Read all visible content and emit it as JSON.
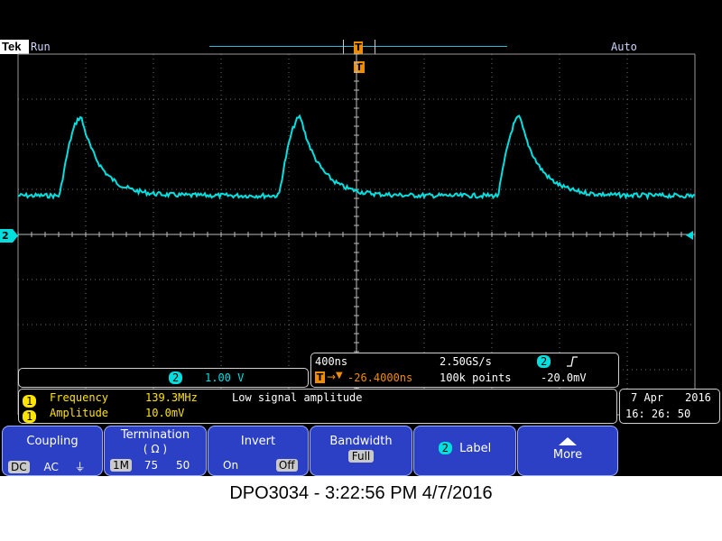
{
  "header": {
    "brand": "Tek",
    "acq_state": "Run",
    "trigger_mode": "Auto",
    "trigger_marker": "T"
  },
  "colors": {
    "ch1": "#ffe400",
    "ch2": "#00dede",
    "trigger": "#f08c00",
    "menu_bg": "#2b40c4",
    "graticule": "#8a8a8a"
  },
  "channel2": {
    "badge": "2",
    "scale": "1.00 V"
  },
  "horizontal": {
    "time_per_div": "400ns",
    "sample_rate": "2.50GS/s",
    "trigger_icon": "T",
    "trigger_delay": "-26.4000ns",
    "record_length": "100k points",
    "trigger_source_badge": "2",
    "trigger_slope": "rising-edge-icon",
    "trigger_level": "-20.0mV"
  },
  "measurements": [
    {
      "badge": "1",
      "name": "Frequency",
      "value": "139.3MHz",
      "note": "Low signal amplitude"
    },
    {
      "badge": "1",
      "name": "Amplitude",
      "value": "10.0mV",
      "note": ""
    }
  ],
  "datetime": {
    "date": "7 Apr",
    "year": "2016",
    "time": "16: 26: 50"
  },
  "menu": {
    "coupling": {
      "title": "Coupling",
      "options": [
        "DC",
        "AC",
        "⏚"
      ],
      "selected": "DC"
    },
    "termination": {
      "title": "Termination",
      "subtitle": "( Ω )",
      "options": [
        "1M",
        "75",
        "50"
      ],
      "selected": "1M"
    },
    "invert": {
      "title": "Invert",
      "options": [
        "On",
        "Off"
      ],
      "selected": "Off"
    },
    "bandwidth": {
      "title": "Bandwidth",
      "value": "Full"
    },
    "label": {
      "badge": "2",
      "title": "Label"
    },
    "more": {
      "title": "More"
    }
  },
  "caption": "DPO3034 - 3:22:56 PM    4/7/2016"
}
